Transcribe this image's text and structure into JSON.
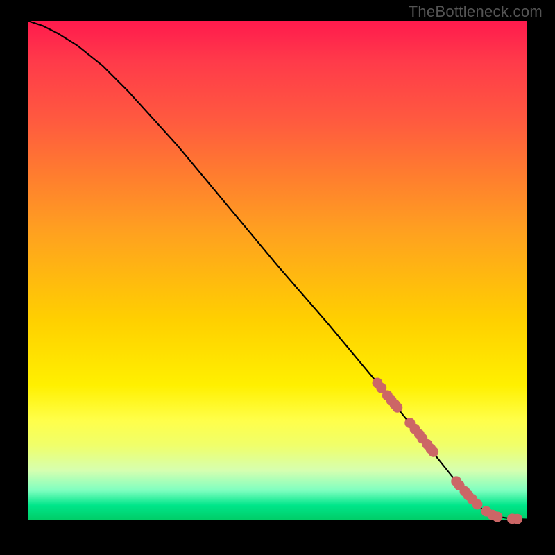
{
  "watermark": "TheBottleneck.com",
  "chart_data": {
    "type": "line",
    "title": "",
    "xlabel": "",
    "ylabel": "",
    "xlim": [
      0,
      100
    ],
    "ylim": [
      0,
      100
    ],
    "grid": false,
    "legend": false,
    "series": [
      {
        "name": "curve",
        "x": [
          0,
          3,
          6,
          10,
          15,
          20,
          30,
          40,
          50,
          60,
          70,
          78,
          84,
          88,
          91,
          93,
          95,
          97,
          100
        ],
        "y": [
          100,
          99,
          97.5,
          95,
          91,
          86,
          75,
          63,
          51,
          39.5,
          27.5,
          17.5,
          10,
          5,
          2.2,
          1.1,
          0.6,
          0.3,
          0.2
        ]
      }
    ],
    "highlight_points": {
      "name": "dots",
      "color": "#cc6666",
      "x": [
        70,
        70.8,
        72,
        72.8,
        73.5,
        74,
        76.5,
        77.5,
        78.4,
        79,
        80,
        80.7,
        81.2,
        85.8,
        86.4,
        87.5,
        88.2,
        89,
        90,
        91.8,
        93,
        94,
        97,
        98
      ],
      "y": [
        27.5,
        26.5,
        25,
        24,
        23.2,
        22.6,
        19.5,
        18.3,
        17.2,
        16.4,
        15.2,
        14.3,
        13.7,
        7.8,
        7,
        5.8,
        5,
        4.2,
        3.2,
        1.8,
        1.1,
        0.7,
        0.3,
        0.25
      ]
    },
    "background_gradient": {
      "direction": "vertical",
      "stops": [
        {
          "pos": 0.0,
          "color": "#ff1a4d"
        },
        {
          "pos": 0.2,
          "color": "#ff5a3f"
        },
        {
          "pos": 0.42,
          "color": "#ffa020"
        },
        {
          "pos": 0.6,
          "color": "#ffd000"
        },
        {
          "pos": 0.8,
          "color": "#ffff4a"
        },
        {
          "pos": 0.94,
          "color": "#7fffc0"
        },
        {
          "pos": 1.0,
          "color": "#00cc66"
        }
      ]
    }
  }
}
